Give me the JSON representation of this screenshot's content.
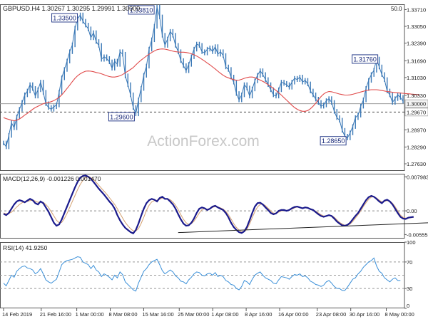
{
  "chart_data": [
    {
      "type": "line",
      "panel": "price",
      "title": "GBPUSD.H4  1.30267 1.30295 1.29991 1.30000",
      "corner_label": "50.0",
      "y_axis_ticks": [
        "1.33710",
        "1.33050",
        "1.32390",
        "1.31690",
        "1.31030",
        "1.30330",
        "1.29670",
        "1.28970",
        "1.28290",
        "1.27630"
      ],
      "ylim": [
        1.2735,
        1.3392
      ],
      "current_price_label": "1.30000",
      "current_price": 1.3,
      "reference_level_label": "1.29670",
      "reference_level": 1.2967,
      "watermark": "ActionForex.com",
      "series": [
        {
          "name": "price",
          "color": "#3a78b6",
          "values": [
            1.2845,
            1.283,
            1.2875,
            1.2925,
            1.2905,
            1.2948,
            1.2978,
            1.3005,
            1.3035,
            1.305,
            1.3075,
            1.306,
            1.303,
            1.3055,
            1.3085,
            1.3045,
            1.3,
            1.2985,
            1.2978,
            1.2988,
            1.2995,
            1.3045,
            1.3102,
            1.3135,
            1.3168,
            1.3205,
            1.3232,
            1.3298,
            1.3335,
            1.335,
            1.3325,
            1.331,
            1.3295,
            1.326,
            1.328,
            1.3245,
            1.323,
            1.3175,
            1.3185,
            1.3178,
            1.3165,
            1.314,
            1.3168,
            1.3155,
            1.3205,
            1.3195,
            1.311,
            1.3075,
            1.3035,
            1.2985,
            1.296,
            1.3015,
            1.306,
            1.3112,
            1.3148,
            1.3215,
            1.3252,
            1.3305,
            1.3381,
            1.3342,
            1.327,
            1.323,
            1.3255,
            1.3285,
            1.327,
            1.323,
            1.3205,
            1.317,
            1.315,
            1.313,
            1.3155,
            1.3185,
            1.3215,
            1.3235,
            1.323,
            1.3205,
            1.32,
            1.3215,
            1.322,
            1.3205,
            1.3225,
            1.3195,
            1.3205,
            1.319,
            1.3145,
            1.3135,
            1.3105,
            1.3085,
            1.304,
            1.3015,
            1.3035,
            1.3075,
            1.3062,
            1.303,
            1.3058,
            1.309,
            1.3112,
            1.313,
            1.3115,
            1.3095,
            1.3075,
            1.3055,
            1.3035,
            1.303,
            1.3055,
            1.3085,
            1.308,
            1.3075,
            1.3065,
            1.3085,
            1.31,
            1.3095,
            1.3105,
            1.3085,
            1.3092,
            1.3078,
            1.305,
            1.3035,
            1.3018,
            1.3005,
            1.299,
            1.2995,
            1.3012,
            1.302,
            1.3005,
            1.297,
            1.2945,
            1.2935,
            1.2895,
            1.2872,
            1.2865,
            1.2885,
            1.291,
            1.2945,
            1.2955,
            1.299,
            1.3015,
            1.306,
            1.3092,
            1.3115,
            1.3132,
            1.3176,
            1.3145,
            1.3115,
            1.3095,
            1.305,
            1.3035,
            1.3005,
            1.302,
            1.3035,
            1.3025,
            1.301
          ]
        },
        {
          "name": "MA(50)",
          "color": "#e04a4a",
          "values": [
            1.2945,
            1.2941,
            1.2938,
            1.2935,
            1.2933,
            1.2935,
            1.294,
            1.2947,
            1.2955,
            1.2962,
            1.297,
            1.2978,
            1.2985,
            1.299,
            1.2995,
            1.3,
            1.3003,
            1.3005,
            1.3008,
            1.3012,
            1.3018,
            1.3025,
            1.3035,
            1.3047,
            1.306,
            1.3073,
            1.3087,
            1.31,
            1.311,
            1.3118,
            1.3124,
            1.3128,
            1.3129,
            1.3128,
            1.3126,
            1.3123,
            1.3121,
            1.3118,
            1.3114,
            1.311,
            1.3107,
            1.3105,
            1.3105,
            1.3107,
            1.311,
            1.3115,
            1.3122,
            1.3128,
            1.3135,
            1.3142,
            1.3153,
            1.3163,
            1.3172,
            1.318,
            1.3188,
            1.3195,
            1.3202,
            1.3208,
            1.3213,
            1.3215,
            1.3216,
            1.3215,
            1.3213,
            1.321,
            1.3207,
            1.3205,
            1.3204,
            1.3203,
            1.3203,
            1.3202,
            1.32,
            1.3197,
            1.3193,
            1.3188,
            1.3182,
            1.3175,
            1.3168,
            1.316,
            1.3153,
            1.3145,
            1.3137,
            1.3128,
            1.312,
            1.3112,
            1.3106,
            1.3102,
            1.3098,
            1.3095,
            1.3092,
            1.3093,
            1.3096,
            1.31,
            1.3103,
            1.3105,
            1.3105,
            1.3103,
            1.3098,
            1.3093,
            1.3088,
            1.3082,
            1.3075,
            1.3068,
            1.306,
            1.3052,
            1.3043,
            1.3034,
            1.3024,
            1.3014,
            1.3004,
            1.2994,
            1.2985,
            1.2978,
            1.2973,
            1.297,
            1.297,
            1.2973,
            1.298,
            1.299,
            1.3002,
            1.3015,
            1.3028,
            1.3038,
            1.3045,
            1.3048,
            1.3047,
            1.3044,
            1.3041,
            1.3038,
            1.3036,
            1.3034,
            1.3034,
            1.3035,
            1.3037,
            1.304,
            1.3043,
            1.3046,
            1.3049,
            1.3052,
            1.3054,
            1.3055,
            1.3055,
            1.3055,
            1.3054,
            1.3052,
            1.305,
            1.3048,
            1.3047,
            1.3045,
            1.3044,
            1.3043,
            1.3042,
            1.3041,
            1.304,
            1.3039,
            1.3038,
            1.3037,
            1.3036,
            1.3035
          ]
        }
      ],
      "annotations": [
        {
          "text": "1.33500",
          "x_index": 29,
          "y": 1.335
        },
        {
          "text": "1.33810",
          "x_index": 58,
          "y": 1.3381
        },
        {
          "text": "1.29600",
          "x_index": 50,
          "y": 1.296
        },
        {
          "text": "1.28650",
          "x_index": 130,
          "y": 1.2865
        },
        {
          "text": "1.31760",
          "x_index": 142,
          "y": 1.3176
        }
      ]
    },
    {
      "type": "line",
      "panel": "macd",
      "title": "MACD(12,26,9) -0.001226 0.001470",
      "y_axis_ticks": [
        "0.007983",
        "0.00",
        "-0.005559"
      ],
      "ylim": [
        -0.0065,
        0.0087
      ],
      "series": [
        {
          "name": "MACD",
          "color": "#1a1a8c",
          "values": [
            -0.0007,
            -0.001,
            -0.0005,
            0.0005,
            0.0015,
            0.0022,
            0.0025,
            0.0023,
            0.002,
            0.0024,
            0.0028,
            0.0025,
            0.0018,
            0.0015,
            0.0022,
            0.0018,
            0.0008,
            -0.0002,
            -0.0015,
            -0.0028,
            -0.0035,
            -0.0032,
            -0.002,
            -0.0005,
            0.001,
            0.0025,
            0.004,
            0.0055,
            0.0068,
            0.0078,
            0.0082,
            0.0083,
            0.008,
            0.0075,
            0.0068,
            0.006,
            0.0052,
            0.0045,
            0.0038,
            0.003,
            0.0022,
            0.0015,
            0.0005,
            -0.001,
            -0.0022,
            -0.0032,
            -0.004,
            -0.0045,
            -0.005,
            -0.0053,
            -0.0045,
            -0.003,
            -0.0012,
            0.0005,
            0.0018,
            0.0025,
            0.0028,
            0.0026,
            0.0022,
            0.003,
            0.0033,
            0.0028,
            0.0028,
            0.0022,
            0.0015,
            0.0005,
            -0.0008,
            -0.002,
            -0.003,
            -0.0035,
            -0.0034,
            -0.0028,
            -0.0018,
            -0.0005,
            0.0005,
            0.0008,
            0.0006,
            0.0002,
            0.0005,
            0.001,
            0.0012,
            0.0008,
            0.0005,
            0.0002,
            -0.0005,
            -0.0015,
            -0.0028,
            -0.0038,
            -0.0045,
            -0.005,
            -0.0052,
            -0.0048,
            -0.0038,
            -0.0022,
            -0.0005,
            0.001,
            0.0018,
            0.0019,
            0.0015,
            0.0008,
            0.0002,
            -0.0005,
            -0.0008,
            -0.0006,
            0.0,
            0.0002,
            0.0002,
            0.0,
            0.0002,
            0.0006,
            0.0009,
            0.001,
            0.0008,
            0.0006,
            0.0008,
            0.0007,
            0.0004,
            0.0002,
            -0.0003,
            -0.0008,
            -0.0012,
            -0.0014,
            -0.0012,
            -0.001,
            -0.0012,
            -0.0018,
            -0.0025,
            -0.003,
            -0.0034,
            -0.0035,
            -0.0033,
            -0.0028,
            -0.002,
            -0.0012,
            -0.0005,
            0.0005,
            0.0015,
            0.0025,
            0.0032,
            0.0035,
            0.0033,
            0.0028,
            0.0022,
            0.0018,
            0.0024,
            0.0026,
            0.0022,
            0.0015,
            0.0005,
            -0.0005,
            -0.0014,
            -0.0018,
            -0.0019,
            -0.0016,
            -0.0015,
            -0.0014
          ]
        },
        {
          "name": "Signal",
          "color": "#d4a070",
          "values": [
            -0.0005,
            -0.0007,
            -0.0006,
            -0.0003,
            0.0003,
            0.0009,
            0.0015,
            0.0019,
            0.0021,
            0.0022,
            0.0024,
            0.0025,
            0.0023,
            0.002,
            0.0021,
            0.002,
            0.0015,
            0.0008,
            -0.0002,
            -0.0012,
            -0.0022,
            -0.0028,
            -0.0027,
            -0.0018,
            -0.0006,
            0.0008,
            0.0022,
            0.0036,
            0.005,
            0.0062,
            0.0072,
            0.0078,
            0.008,
            0.0078,
            0.0074,
            0.0067,
            0.006,
            0.0053,
            0.0046,
            0.0039,
            0.0031,
            0.0023,
            0.0015,
            0.0005,
            -0.0006,
            -0.0017,
            -0.0027,
            -0.0035,
            -0.0042,
            -0.0047,
            -0.0047,
            -0.0042,
            -0.003,
            -0.0015,
            0.0001,
            0.0013,
            0.0021,
            0.0024,
            0.0025,
            0.0027,
            0.003,
            0.0029,
            0.0028,
            0.0026,
            0.0021,
            0.0013,
            0.0003,
            -0.0009,
            -0.002,
            -0.0028,
            -0.0032,
            -0.003,
            -0.0024,
            -0.0015,
            -0.0005,
            0.0003,
            0.0005,
            0.0004,
            0.0005,
            0.0008,
            0.001,
            0.0009,
            0.0007,
            0.0004,
            -0.0001,
            -0.0009,
            -0.0019,
            -0.003,
            -0.0039,
            -0.0045,
            -0.0049,
            -0.0049,
            -0.0043,
            -0.0031,
            -0.0016,
            -0.0002,
            0.0009,
            0.0015,
            0.0016,
            0.0012,
            0.0006,
            0.0,
            -0.0005,
            -0.0006,
            -0.0003,
            0.0,
            0.0001,
            0.0001,
            0.0002,
            0.0004,
            0.0007,
            0.0009,
            0.0008,
            0.0007,
            0.0007,
            0.0007,
            0.0005,
            0.0003,
            -0.0001,
            -0.0005,
            -0.0009,
            -0.0012,
            -0.0012,
            -0.0011,
            -0.0011,
            -0.0015,
            -0.0021,
            -0.0027,
            -0.0031,
            -0.0034,
            -0.0034,
            -0.0031,
            -0.0025,
            -0.0017,
            -0.0009,
            0.0,
            0.001,
            0.0019,
            0.0027,
            0.0032,
            0.0033,
            0.003,
            0.0025,
            0.0021,
            0.0022,
            0.0024,
            0.0023,
            0.0018,
            0.001,
            0.0,
            -0.001,
            -0.0015,
            -0.0017,
            -0.0017,
            -0.0016,
            -0.0015
          ]
        }
      ],
      "trendline": {
        "from": {
          "x_index": 66,
          "y": -0.0051
        },
        "to": {
          "x_index": 159,
          "y": -0.0028
        }
      }
    },
    {
      "type": "line",
      "panel": "rsi",
      "title": "RSI(14) 41.9250",
      "y_axis_ticks": [
        "100",
        "70",
        "30",
        "0"
      ],
      "ylim": [
        0,
        100
      ],
      "levels": [
        70,
        50,
        30
      ],
      "series": [
        {
          "name": "RSI",
          "color": "#3a8fd8",
          "values": [
            38,
            34,
            42,
            50,
            47,
            56,
            60,
            63,
            64,
            61,
            60,
            58,
            52,
            55,
            60,
            52,
            43,
            40,
            38,
            41,
            44,
            55,
            66,
            70,
            72,
            73,
            74,
            76,
            78,
            77,
            70,
            68,
            66,
            60,
            65,
            58,
            55,
            48,
            52,
            50,
            47,
            43,
            50,
            46,
            55,
            51,
            40,
            36,
            32,
            28,
            26,
            38,
            47,
            56,
            60,
            66,
            70,
            72,
            74,
            66,
            57,
            52,
            55,
            58,
            55,
            49,
            46,
            41,
            40,
            37,
            43,
            47,
            52,
            55,
            54,
            50,
            49,
            52,
            53,
            50,
            54,
            48,
            50,
            48,
            42,
            40,
            36,
            35,
            30,
            28,
            33,
            42,
            40,
            36,
            44,
            50,
            53,
            55,
            50,
            46,
            44,
            42,
            38,
            37,
            43,
            48,
            47,
            46,
            44,
            48,
            51,
            50,
            52,
            48,
            49,
            46,
            41,
            39,
            36,
            35,
            33,
            35,
            40,
            42,
            38,
            33,
            30,
            30,
            27,
            27,
            32,
            38,
            44,
            46,
            52,
            56,
            62,
            66,
            70,
            72,
            76,
            64,
            56,
            53,
            46,
            43,
            40,
            44,
            46,
            42,
            42
          ]
        }
      ]
    }
  ],
  "x_axis": {
    "ticks": [
      {
        "label": "14 Feb 2019",
        "index": 0
      },
      {
        "label": "21 Feb 16:00",
        "index": 18
      },
      {
        "label": "1 Mar 00:00",
        "index": 35
      },
      {
        "label": "8 Mar 08:00",
        "index": 51
      },
      {
        "label": "15 Mar 16:00",
        "index": 67
      },
      {
        "label": "25 Mar 00:00",
        "index": 84
      },
      {
        "label": "1 Apr 08:00",
        "index": 100
      },
      {
        "label": "8 Apr 16:00",
        "index": 116
      },
      {
        "label": "16 Apr 00:00",
        "index": 132
      },
      {
        "label": "23 Apr 08:00",
        "index": 150
      },
      {
        "label": "30 Apr 16:00",
        "index": 166
      },
      {
        "label": "8 May 00:00",
        "index": 183
      }
    ]
  }
}
